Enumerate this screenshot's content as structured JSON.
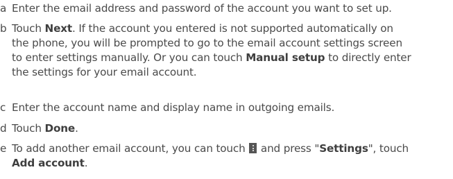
{
  "steps": {
    "a": {
      "letter": "a",
      "text": "Enter the email address and password of the account you want to set up."
    },
    "b": {
      "letter": "b",
      "pre": "Touch ",
      "next": "Next",
      "line1_rest": ". If the account you entered is not supported automatically on",
      "line2": "the phone, you will be prompted to go to the email account settings screen",
      "line3_pre": "to enter settings manually. Or you can touch ",
      "manual_setup": "Manual setup",
      "line3_post": " to directly enter",
      "line4": "the settings for your email account."
    },
    "c": {
      "letter": "c",
      "text": "Enter the account name and display name in outgoing emails."
    },
    "d": {
      "letter": "d",
      "pre": "Touch ",
      "done": "Done",
      "post": "."
    },
    "e": {
      "letter": "e",
      "pre": "To add another email account, you can touch ",
      "icon": "menu-icon",
      "mid": " and press \"",
      "settings": "Settings",
      "post": "\", touch",
      "add_account": "Add account",
      "end": "."
    }
  }
}
